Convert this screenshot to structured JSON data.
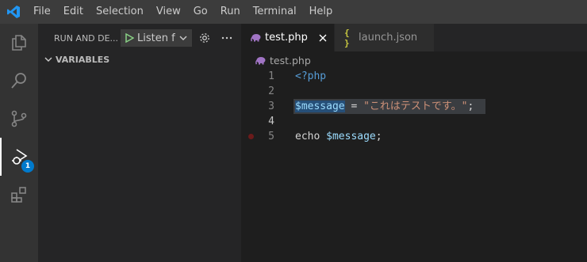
{
  "menu": [
    "File",
    "Edit",
    "Selection",
    "View",
    "Go",
    "Run",
    "Terminal",
    "Help"
  ],
  "activity": {
    "debug_badge": "1"
  },
  "sidebar": {
    "title": "RUN AND DE...",
    "launch_config": "Listen f",
    "section": "VARIABLES"
  },
  "tabs": [
    {
      "label": "test.php",
      "icon": "php-elephant-icon",
      "active": true
    },
    {
      "label": "launch.json",
      "icon": "json-braces-icon",
      "icon_text": "{ }",
      "active": false
    }
  ],
  "breadcrumb": "test.php",
  "editor": {
    "line_numbers": [
      "1",
      "2",
      "3",
      "4",
      "5"
    ],
    "current_line": "4",
    "breakpoint_line": "5",
    "lines": {
      "l1": "<?php",
      "l3_var": "$message",
      "l3_eq": " = ",
      "l3_str": "\"これはテストです。\"",
      "l3_semi": ";",
      "l5_echo": "echo ",
      "l5_var": "$message",
      "l5_semi": ";"
    }
  },
  "colors": {
    "accent": "#007acc",
    "play": "#89d185",
    "php_icon": "#a074c4",
    "breakpoint": "#6b1b1b"
  }
}
